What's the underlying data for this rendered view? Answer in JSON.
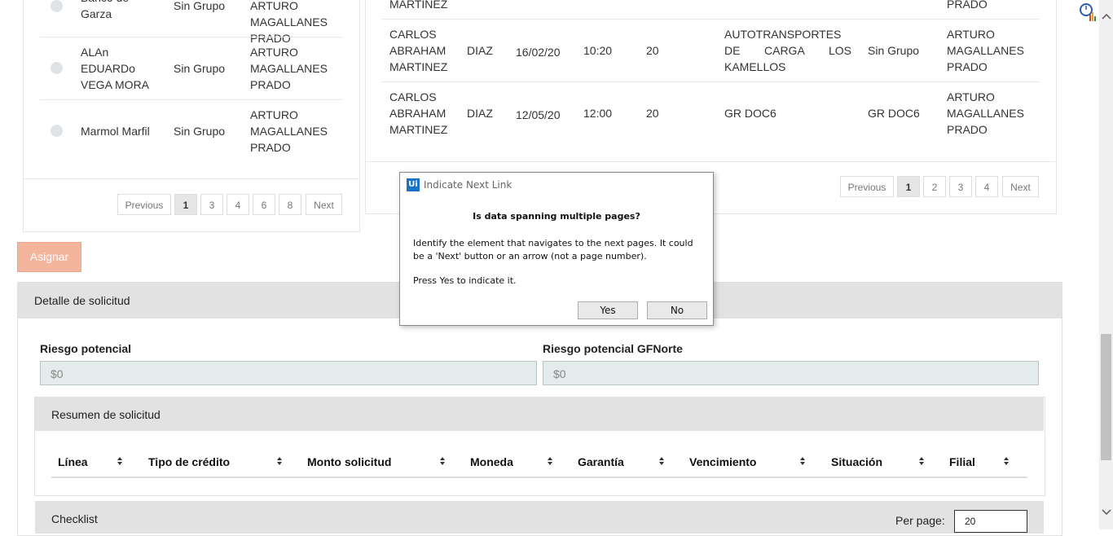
{
  "left_table": {
    "rows": [
      {
        "name": "Banco de Garza",
        "group": "Sin Grupo",
        "exec": "ARTURO MAGALLANES PRADO"
      },
      {
        "name": "ALAn EDUARDo VEGA MORA",
        "group": "Sin Grupo",
        "exec": "ARTURO MAGALLANES PRADO"
      },
      {
        "name": "Marmol Marfil",
        "group": "Sin Grupo",
        "exec": "ARTURO MAGALLANES PRADO"
      }
    ],
    "pagination": {
      "previous": "Previous",
      "pages": [
        "1",
        "3",
        "4",
        "6",
        "8"
      ],
      "next": "Next"
    }
  },
  "right_table": {
    "top_fragment": {
      "c1": "MARTINEZ",
      "c2": "PRADO"
    },
    "rows": [
      {
        "name": "CARLOS ABRAHAM DIAZ MARTINEZ",
        "name_l1": "CARLOS",
        "name_l2": "ABRAHAM",
        "name_l2b": "DIAZ",
        "name_l3": "MARTINEZ",
        "date": "16/02/20",
        "time": "10:20",
        "qty": "20",
        "company_l1": "AUTOTRANSPORTES",
        "company_l2a": "DE",
        "company_l2b": "CARGA",
        "company_l2c": "LOS",
        "company_l3": "KAMELLOS",
        "group": "Sin Grupo",
        "exec_l1": "ARTURO",
        "exec_l2": "MAGALLANES",
        "exec_l3": "PRADO"
      },
      {
        "name_l1": "CARLOS",
        "name_l2": "ABRAHAM",
        "name_l2b": "DIAZ",
        "name_l3": "MARTINEZ",
        "date": "12/05/20",
        "time": "12:00",
        "qty": "20",
        "company_l1": "GR DOC6",
        "group": "GR DOC6",
        "exec_l1": "ARTURO",
        "exec_l2": "MAGALLANES",
        "exec_l3": "PRADO"
      }
    ],
    "pagination": {
      "previous": "Previous",
      "pages": [
        "1",
        "2",
        "3",
        "4"
      ],
      "next": "Next"
    }
  },
  "asignar_label": "Asignar",
  "detalle": {
    "title": "Detalle de solicitud",
    "riesgo_label": "Riesgo potencial",
    "riesgo_value": "$0",
    "riesgo_gf_label": "Riesgo potencial GFNorte",
    "riesgo_gf_value": "$0"
  },
  "resumen": {
    "title": "Resumen de solicitud",
    "columns": [
      "Línea",
      "Tipo de crédito",
      "Monto solicitud",
      "Moneda",
      "Garantía",
      "Vencimiento",
      "Situación",
      "Filial"
    ]
  },
  "checklist": {
    "title": "Checklist",
    "per_page_label": "Per page:",
    "per_page_value": "20"
  },
  "dialog": {
    "title": "Indicate Next Link",
    "logo": "Ui",
    "question": "Is data spanning multiple pages?",
    "body1": "Identify the element that navigates to the next pages. It could be a 'Next' button or an arrow (not a page number).",
    "body2": "Press Yes to indicate it.",
    "yes": "Yes",
    "no": "No"
  }
}
